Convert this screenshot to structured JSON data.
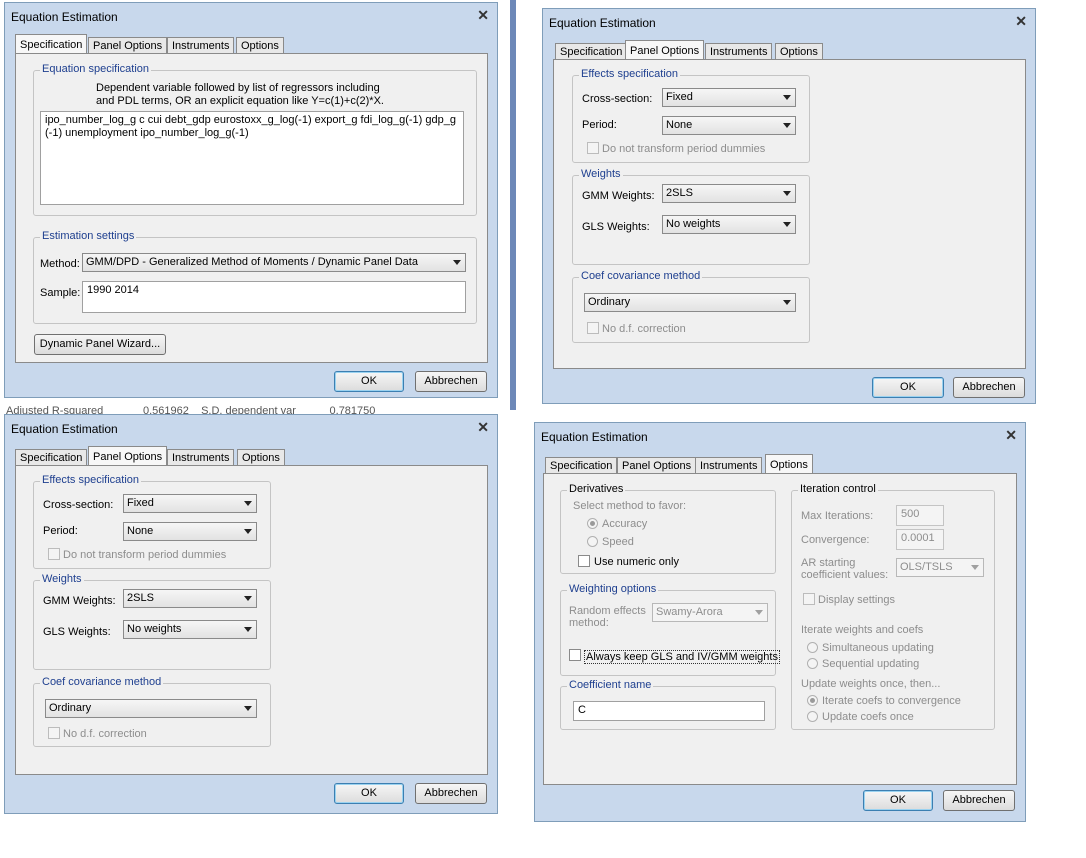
{
  "dialog_title": "Equation Estimation",
  "close_glyph": "✕",
  "tabs": [
    "Specification",
    "Panel Options",
    "Instruments",
    "Options"
  ],
  "buttons": {
    "ok": "OK",
    "cancel": "Abbrechen"
  },
  "background_text": {
    "row1": "Adjusted R-squared",
    "row1_val": "0.561962",
    "row1_lbl": "S.D. dependent var",
    "row1_val2": "0.781750"
  },
  "spec": {
    "group_equation": "Equation specification",
    "hint_line1": "Dependent variable followed by list of regressors including",
    "hint_line2": "and PDL terms, OR an explicit equation like Y=c(1)+c(2)*X.",
    "equation_line1": "ipo_number_log_g c cui debt_gdp eurostoxx_g_log(-1) export_g fdi_log_g(-1) gdp_g",
    "equation_line2": "(-1) unemployment ipo_number_log_g(-1)",
    "group_estimation": "Estimation settings",
    "method_label": "Method:",
    "method_value": "GMM/DPD  -  Generalized Method of Moments / Dynamic Panel Data",
    "sample_label": "Sample:",
    "sample_value": "1990 2014",
    "wizard_button": "Dynamic Panel Wizard..."
  },
  "panel": {
    "group_effects": "Effects specification",
    "cross_label": "Cross-section:",
    "cross_value": "Fixed",
    "period_label": "Period:",
    "period_value": "None",
    "no_transform": "Do not transform period dummies",
    "group_weights": "Weights",
    "gmm_label": "GMM Weights:",
    "gmm_value": "2SLS",
    "gls_label": "GLS Weights:",
    "gls_value": "No weights",
    "group_coef": "Coef covariance method",
    "coef_value": "Ordinary",
    "no_df": "No d.f. correction"
  },
  "options": {
    "group_derivatives": "Derivatives",
    "favor_label": "Select method to favor:",
    "accuracy": "Accuracy",
    "speed": "Speed",
    "numeric_only": "Use numeric only",
    "group_weighting": "Weighting options",
    "random_label_1": "Random effects",
    "random_label_2": "method:",
    "random_value": "Swamy-Arora",
    "always_keep": "Always keep GLS and IV/GMM weights",
    "group_coefname": "Coefficient name",
    "coefname_value": "C",
    "group_iteration": "Iteration control",
    "max_iter_label": "Max Iterations:",
    "max_iter_value": "500",
    "convergence_label": "Convergence:",
    "convergence_value": "0.0001",
    "ar_label_1": "AR starting",
    "ar_label_2": "coefficient values:",
    "ar_value": "OLS/TSLS",
    "display_settings": "Display settings",
    "iterate_label": "Iterate weights and coefs",
    "simultaneous": "Simultaneous updating",
    "sequential": "Sequential updating",
    "update_once_label": "Update weights once, then...",
    "iterate_coefs": "Iterate coefs to convergence",
    "update_coefs": "Update coefs once"
  }
}
